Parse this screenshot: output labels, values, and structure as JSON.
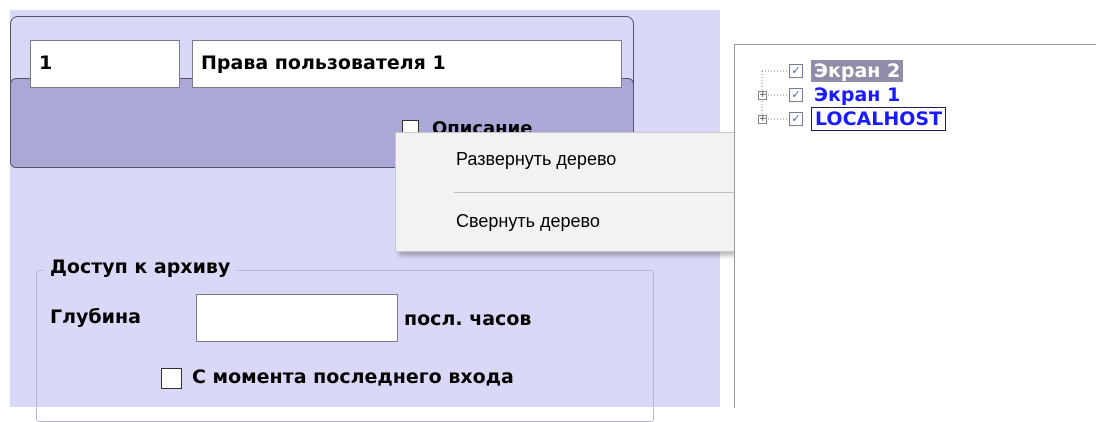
{
  "header": {
    "id_value": "1",
    "name_value": "Права пользователя 1",
    "hidden_checkbox_label": "Описание"
  },
  "context_menu": {
    "items": [
      "Развернуть дерево",
      "Свернуть дерево"
    ]
  },
  "archive_group": {
    "title": "Доступ к архиву",
    "depth_label": "Глубина",
    "depth_value": "",
    "depth_unit": "посл. часов",
    "since_last_login_label": "С момента последнего входа",
    "since_last_login_checked": false
  },
  "tree": {
    "items": [
      {
        "label": "Экран 2",
        "checked": true,
        "expandable": false,
        "selected": true
      },
      {
        "label": "Экран 1",
        "checked": true,
        "expandable": true,
        "selected": false
      },
      {
        "label": "LOCALHOST",
        "checked": true,
        "expandable": true,
        "selected": false
      }
    ]
  },
  "colors": {
    "panel_bg": "#d9d8f6",
    "inner_box_bg": "#a9a8d6",
    "tree_selected_bg": "#8f8da8",
    "tree_link_color": "#1a1aff"
  }
}
